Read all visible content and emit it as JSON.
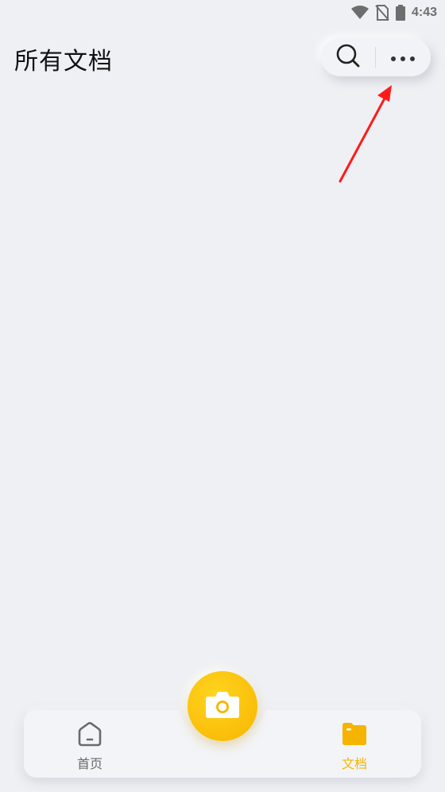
{
  "status_bar": {
    "time": "4:43",
    "icons": [
      "wifi-icon",
      "no-sim-icon",
      "battery-icon"
    ]
  },
  "header": {
    "title": "所有文档"
  },
  "actions": {
    "search_icon": "search-icon",
    "more_icon": "more-icon"
  },
  "tab_bar": {
    "items": [
      {
        "label": "首页",
        "icon": "home-icon",
        "active": false
      },
      {
        "label": "文档",
        "icon": "folder-icon",
        "active": true
      }
    ],
    "camera_icon": "camera-icon"
  },
  "colors": {
    "background": "#eff0f3",
    "accent": "#f4b400",
    "annotation": "#ff1a1a"
  }
}
